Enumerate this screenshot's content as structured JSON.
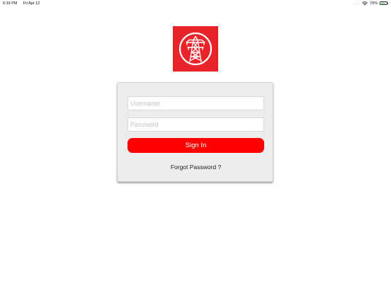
{
  "status_bar": {
    "time": "6:19 PM",
    "date": "Fri Apr 12",
    "dots": "....",
    "battery_percent": "79%",
    "battery_level": 0.79,
    "wifi_icon": "wifi-icon",
    "battery_icon": "battery-icon"
  },
  "logo": {
    "icon": "power-pylon-icon",
    "background_color": "#e8232a"
  },
  "login": {
    "username_placeholder": "Username",
    "username_value": "",
    "password_placeholder": "Password",
    "password_value": "",
    "signin_label": "Sign In",
    "signin_color": "#ff0000",
    "forgot_label": "Forgot Password ?"
  }
}
